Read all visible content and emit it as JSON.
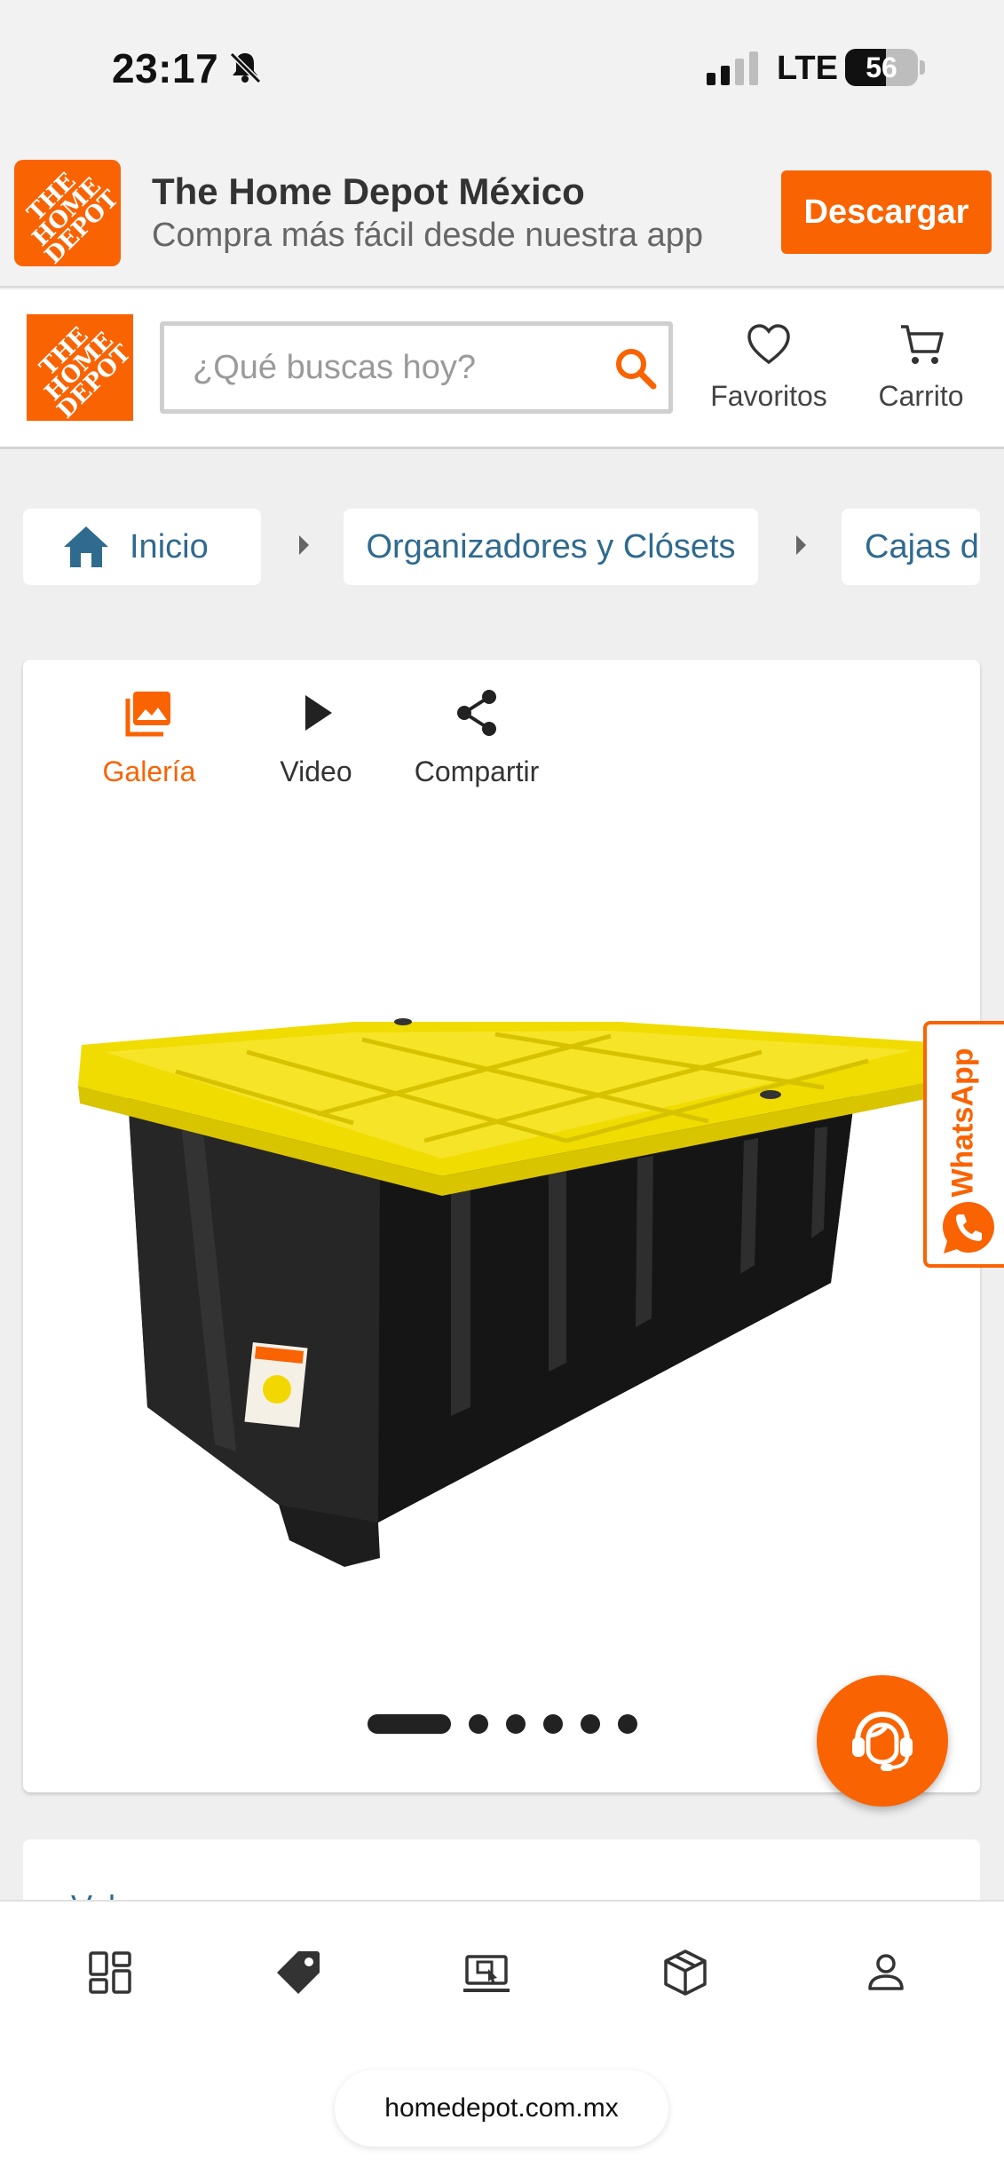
{
  "status_bar": {
    "time": "23:17",
    "network": "LTE",
    "battery": "56",
    "battery_level": 0.56,
    "icons": [
      "bell-slash-icon",
      "signal-icon",
      "battery-icon"
    ]
  },
  "app_banner": {
    "logo_text": "THE HOME DEPOT",
    "title": "The Home Depot México",
    "subtitle": "Compra más fácil desde nuestra app",
    "download_label": "Descargar"
  },
  "header": {
    "logo_text": "THE HOME DEPOT",
    "search_placeholder": "¿Qué buscas hoy?",
    "favorites_label": "Favoritos",
    "cart_label": "Carrito"
  },
  "breadcrumb": {
    "items": [
      "Inicio",
      "Organizadores y Clósets",
      "Cajas de"
    ]
  },
  "product_toolbar": {
    "gallery_label": "Galería",
    "video_label": "Video",
    "share_label": "Compartir"
  },
  "gallery": {
    "image_count": 6,
    "active_index": 0
  },
  "whatsapp": {
    "label": "WhatsApp"
  },
  "next_section": {
    "peek_text": "Vol"
  },
  "bottom_nav": {
    "items": [
      "categories-icon",
      "tag-icon",
      "store-icon",
      "package-icon",
      "user-icon"
    ]
  },
  "browser": {
    "url": "homedepot.com.mx"
  },
  "colors": {
    "brand_orange": "#f96302",
    "link_blue": "#2f6a8f",
    "lid_yellow": "#f2e000",
    "box_black": "#1e1e1e"
  }
}
